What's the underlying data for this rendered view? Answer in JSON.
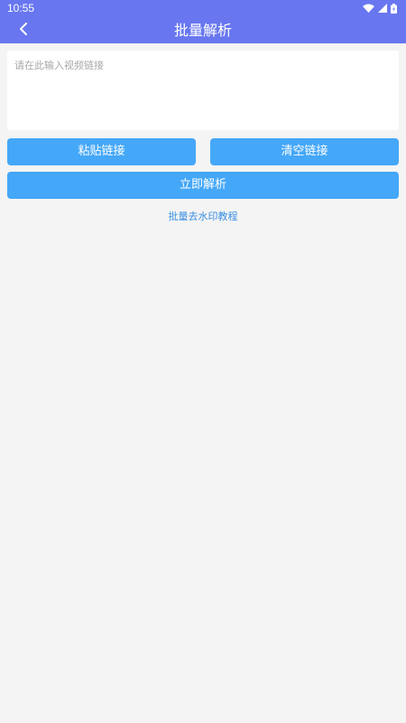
{
  "status_bar": {
    "time": "10:55",
    "icons": [
      "wifi-icon",
      "signal-icon",
      "battery-icon"
    ]
  },
  "app_bar": {
    "title": "批量解析",
    "back_icon": "chevron-left-icon"
  },
  "input": {
    "placeholder": "请在此输入视频链接",
    "value": ""
  },
  "buttons": {
    "paste_label": "粘贴链接",
    "clear_label": "清空链接",
    "parse_label": "立即解析"
  },
  "tutorial_link": "批量去水印教程",
  "colors": {
    "header_bg": "#6877f0",
    "button_bg": "#44a7f8",
    "link": "#3a8fe0",
    "page_bg": "#f4f4f4"
  }
}
